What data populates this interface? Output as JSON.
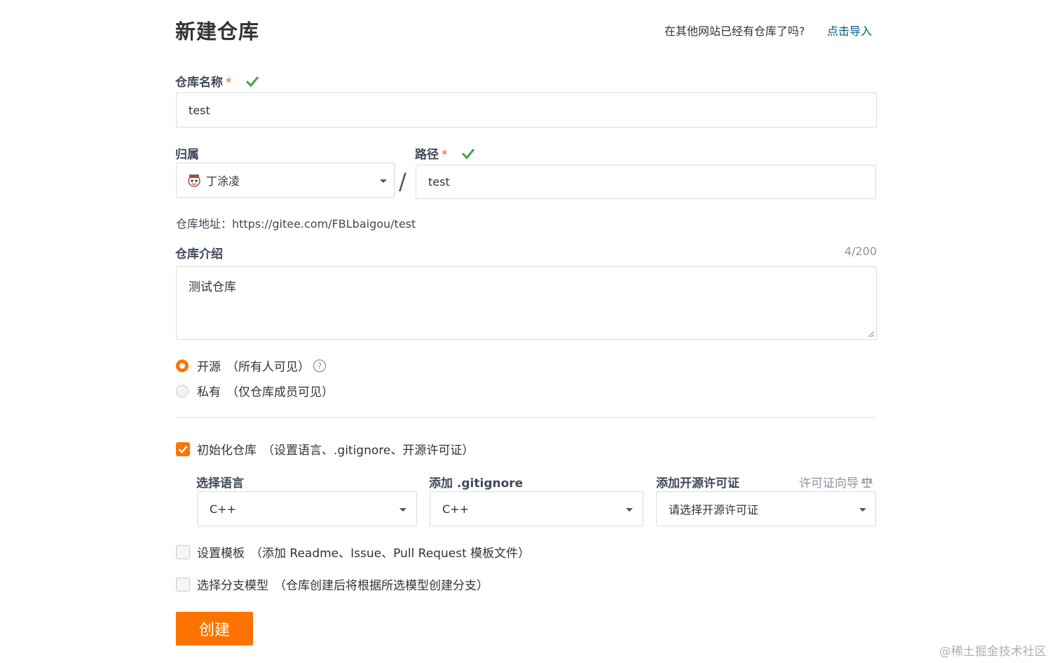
{
  "page": {
    "title": "新建仓库",
    "import_question": "在其他网站已经有仓库了吗?",
    "import_link": "点击导入"
  },
  "repo_name": {
    "label": "仓库名称",
    "required_mark": "*",
    "value": "test"
  },
  "owner": {
    "label": "归属",
    "value": "丁涂凌",
    "separator": "/"
  },
  "path": {
    "label": "路径",
    "required_mark": "*",
    "value": "test"
  },
  "repo_address": {
    "text": "仓库地址：https://gitee.com/FBLbaigou/test"
  },
  "description": {
    "label": "仓库介绍",
    "counter": "4/200",
    "value": "测试仓库"
  },
  "visibility": {
    "options": [
      {
        "label": "开源",
        "note": "（所有人可见）",
        "selected": true
      },
      {
        "label": "私有",
        "note": "（仅仓库成员可见）",
        "selected": false
      }
    ]
  },
  "init_repo": {
    "label": "初始化仓库",
    "note": "（设置语言、.gitignore、开源许可证）",
    "checked": true
  },
  "language": {
    "label": "选择语言",
    "value": "C++"
  },
  "gitignore": {
    "label": "添加 .gitignore",
    "value": "C++"
  },
  "license": {
    "label": "添加开源许可证",
    "guide": "许可证向导",
    "value": "请选择开源许可证"
  },
  "templates": {
    "label": "设置模板",
    "note": "（添加 Readme、Issue、Pull Request 模板文件）",
    "checked": false
  },
  "branch_model": {
    "label": "选择分支模型",
    "note": "（仓库创建后将根据所选模型创建分支）",
    "checked": false
  },
  "submit": {
    "label": "创建"
  },
  "watermark": "@稀土掘金技术社区",
  "colors": {
    "accent": "#fe7300",
    "link": "#005980",
    "check": "#3fa64a"
  },
  "icons": [
    "check-icon",
    "avatar-icon",
    "question-circle-icon",
    "scale-icon",
    "caret-down-icon"
  ]
}
